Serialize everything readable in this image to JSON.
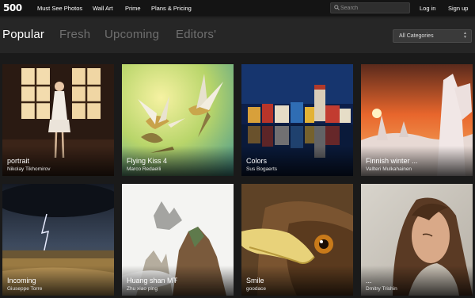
{
  "header": {
    "logo_text": "500",
    "nav": [
      "Must See Photos",
      "Wall Art",
      "Prime",
      "Plans & Pricing"
    ],
    "search_placeholder": "Search",
    "login_label": "Log in",
    "signup_label": "Sign up"
  },
  "tabs": [
    "Popular",
    "Fresh",
    "Upcoming",
    "Editors'"
  ],
  "active_tab": "Popular",
  "category_select": {
    "selected": "All Categories"
  },
  "photos": [
    {
      "title": "portrait",
      "author": "Nikolay Tikhomirov"
    },
    {
      "title": "Flying Kiss 4",
      "author": "Marco Redaelli"
    },
    {
      "title": "Colors",
      "author": "Sus Bogaerts"
    },
    {
      "title": "Finnish winter ...",
      "author": "Vallteri Mulkahainen"
    },
    {
      "title": "Incoming",
      "author": "Giuseppe Torre"
    },
    {
      "title": "Huang shan MT",
      "author": "Zhu xiao ping"
    },
    {
      "title": "Smile",
      "author": "goodace"
    },
    {
      "title": "...",
      "author": "Dmitry Trishin"
    }
  ],
  "colors": {
    "background": "#1a1a1a",
    "header": "#141414",
    "subbar": "#262626",
    "inactive_tab": "#6f6f6f"
  }
}
